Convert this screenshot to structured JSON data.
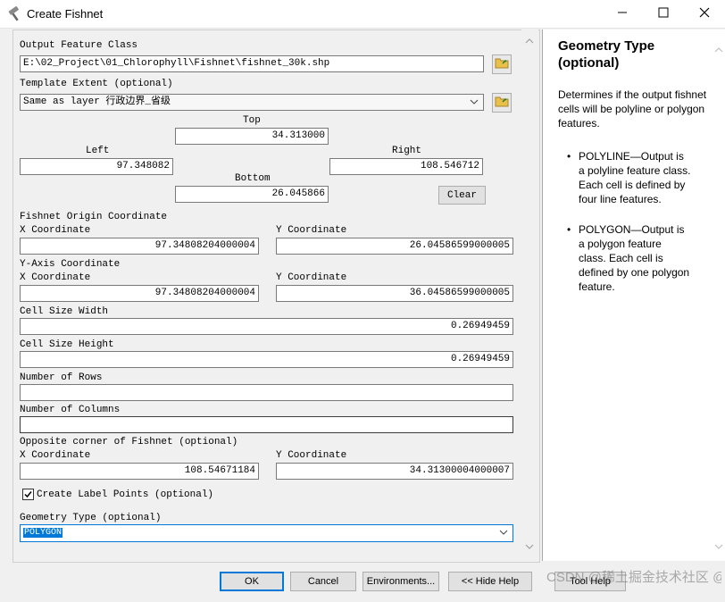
{
  "window": {
    "title": "Create Fishnet"
  },
  "form": {
    "output_label": "Output Feature Class",
    "output_value": "E:\\02_Project\\01_Chlorophyll\\Fishnet\\fishnet_30k.shp",
    "template_label": "Template Extent (optional)",
    "template_value": "Same as layer 行政边界_省级",
    "top_label": "Top",
    "top_value": "34.313000",
    "left_label": "Left",
    "left_value": "97.348082",
    "right_label": "Right",
    "right_value": "108.546712",
    "bottom_label": "Bottom",
    "bottom_value": "26.045866",
    "clear_label": "Clear",
    "origin_label": "Fishnet Origin Coordinate",
    "origin_x_label": "X Coordinate",
    "origin_x_value": "97.34808204000004",
    "origin_y_label": "Y Coordinate",
    "origin_y_value": "26.04586599000005",
    "yaxis_label": "Y-Axis Coordinate",
    "yaxis_x_label": "X Coordinate",
    "yaxis_x_value": "97.34808204000004",
    "yaxis_y_label": "Y Coordinate",
    "yaxis_y_value": "36.04586599000005",
    "cell_width_label": "Cell Size Width",
    "cell_width_value": "0.26949459",
    "cell_height_label": "Cell Size Height",
    "cell_height_value": "0.26949459",
    "rows_label": "Number of Rows",
    "rows_value": "",
    "cols_label": "Number of Columns",
    "cols_value": "",
    "opposite_label": "Opposite corner of Fishnet (optional)",
    "opp_x_label": "X Coordinate",
    "opp_x_value": "108.54671184",
    "opp_y_label": "Y Coordinate",
    "opp_y_value": "34.31300004000007",
    "label_points_label": "Create Label Points (optional)",
    "label_points_checked": true,
    "geometry_label": "Geometry Type (optional)",
    "geometry_value": "POLYGON"
  },
  "help": {
    "title": "Geometry Type (optional)",
    "intro": "Determines if the output fishnet cells will be polyline or polygon features.",
    "items": [
      "POLYLINE—Output is a polyline feature class. Each cell is defined by four line features.",
      "POLYGON—Output is a polygon feature class. Each cell is defined by one polygon feature."
    ]
  },
  "buttons": {
    "ok": "OK",
    "cancel": "Cancel",
    "environments": "Environments...",
    "hide_help": "<< Hide Help",
    "tool_help": "Tool Help"
  },
  "watermark": "CSDN @稀土掘金技术社区 @风雅学习GIS"
}
